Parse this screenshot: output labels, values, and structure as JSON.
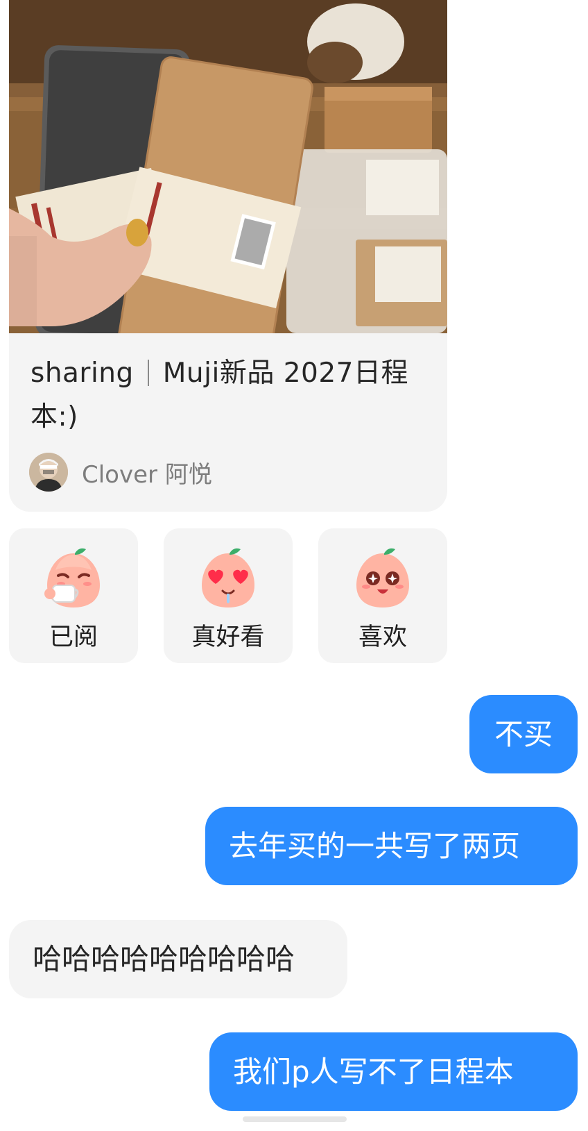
{
  "post": {
    "title_part1": "sharing",
    "title_part2": "Muji新品 2027日程本:)",
    "author_name": "Clover 阿悦"
  },
  "reactions": [
    {
      "label": "已阅",
      "icon": "sipping-tea-peach-icon"
    },
    {
      "label": "真好看",
      "icon": "heart-eyes-peach-icon"
    },
    {
      "label": "喜欢",
      "icon": "sparkle-eyes-peach-icon"
    }
  ],
  "messages": [
    {
      "side": "outgoing",
      "text": "不买"
    },
    {
      "side": "outgoing",
      "text": "去年买的一共写了两页"
    },
    {
      "side": "incoming",
      "text": "哈哈哈哈哈哈哈哈哈"
    },
    {
      "side": "outgoing",
      "text": "我们p人写不了日程本"
    }
  ],
  "colors": {
    "outgoing_bubble": "#2b8cff",
    "incoming_bubble": "#f4f4f4",
    "card_background": "#f4f4f4"
  }
}
